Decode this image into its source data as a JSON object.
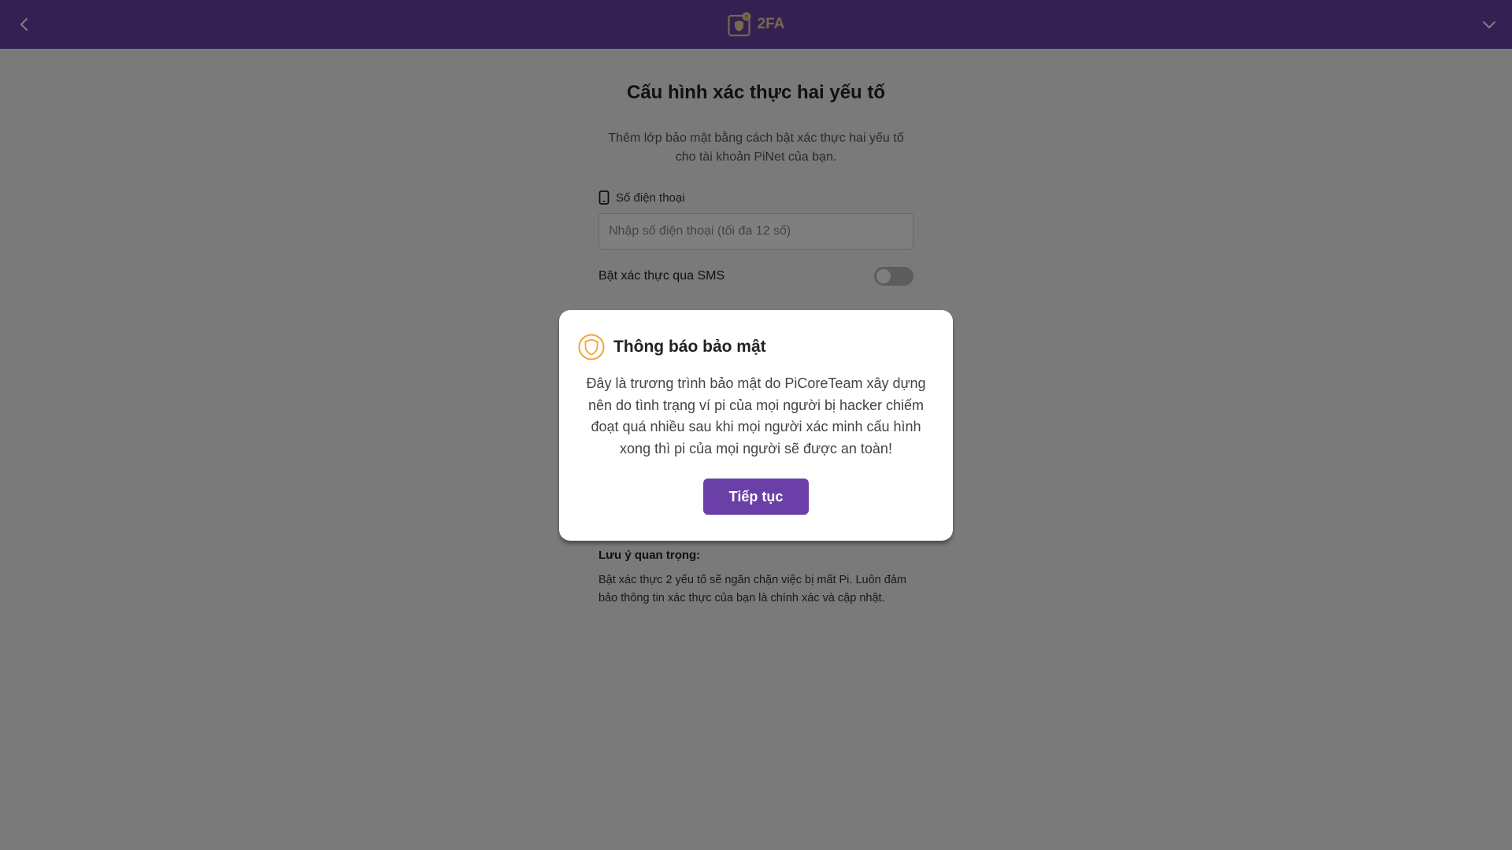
{
  "header": {
    "title": "2FA",
    "logo_badge": "π",
    "back_icon": "chevron-left-icon",
    "menu_icon": "chevron-down-icon"
  },
  "main": {
    "title": "Cấu hình xác thực hai yếu tố",
    "description": "Thêm lớp bảo mật bằng cách bật xác thực hai yếu tố cho tài khoản PiNet của bạn.",
    "phone_label": "Số điện thoại",
    "phone_icon": "phone-icon",
    "phone_placeholder": "Nhập số điện thoại (tối đa 12 số)",
    "phone_value": "",
    "sms_label": "Bật xác thực qua SMS",
    "sms_enabled": false,
    "note_title": "Lưu ý quan trọng:",
    "note_body": "Bật xác thực 2 yếu tố sẽ ngăn chặn việc bị mất Pi. Luôn đảm bảo thông tin xác thực của bạn là chính xác và cập nhật."
  },
  "modal": {
    "title": "Thông báo bảo mật",
    "icon": "shield-icon",
    "body": "Đây là trương trình bảo mật do PiCoreTeam xây dựng nên do tình trạng ví pi của mọi người bị hacker chiếm đoạt quá nhiều sau khi mọi người xác minh cấu hình xong thì pi của mọi người sẽ được an toàn!",
    "button_label": "Tiếp tục"
  },
  "colors": {
    "header_bg": "#6a40a8",
    "accent": "#6a40a8",
    "brand_gold": "#f0d19a",
    "shield_orange": "#f2a533"
  }
}
